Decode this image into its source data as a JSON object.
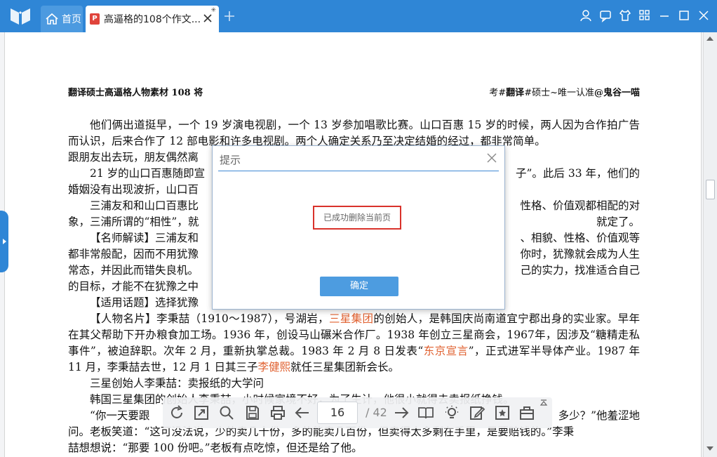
{
  "titlebar": {
    "tabs": [
      {
        "label": "首页"
      },
      {
        "label": "高逼格的108个作文..."
      }
    ]
  },
  "document": {
    "header_left": "翻译硕士高逼格人物素材 108 将",
    "header_right_prefix": "考#",
    "header_right_b1": "翻译",
    "header_right_mid": "#硕士~唯一认准",
    "header_right_b2": "@鬼谷一喵",
    "lines": [
      "他们俩出道挺早，一个 19 岁演电视剧，一个 13 岁参加唱歌比赛。山口百惠 15 岁的时候，两人因为合",
      "作拍广告而认识，后来合作了 12 部电影和许多电视剧。两个人确定关系乃至决定结婚的经过，都非常简单。",
      "跟朋友出去玩，朋友偶然离",
      "21 岁的山口百惠随即宣",
      "子”。此后 33 年，他们的",
      "婚姻没有出现波折，山口百",
      "三浦友和和山口百惠比",
      "性格、价值观都相配的对",
      "象，三浦所谓的“相性”，就",
      "就定了。",
      "【名师解读】三浦友和",
      "、相貌、性格、价值观等",
      "都非常般配，因而不用犹豫",
      "你时，犹豫就会成为人生",
      "常态，并因此而错失良机。",
      "己的实力，找准适合自己",
      "的目标，才能不在犹豫之中",
      "【适用话题】选择犹豫",
      "【人物名片】李秉喆（1910～1987），号湖岩，",
      "三星集团",
      "的创始人，是韩国庆尚南道宜宁郡出身的实",
      "业家。早年在其父帮助下开办粮食加工场。1936 年，创设马山碾米合作厂。1938 年创立三星商会，1967",
      "年，因涉及“糖精走私事件”，被迫辞职。次年 2 月，重新执掌总裁。1983 年 2 月 8 日发表“",
      "东京宣言",
      "”，正式",
      "进军半导体产业。1987 年 11 月，李秉喆去世，12 月 1 日其三子",
      "李健熙",
      "就任三星集团新会长。",
      "三星创始人李秉喆：卖报纸的大学问",
      "韩国三星集团的创始人李秉喆，小时候家境不好，为了生计，他很小就得去卖报纸挣钱。",
      "“你一天要跟",
      "多少？”他羞涩地",
      "问。老板笑道：“这可没法说，少的卖几十份，多的能卖几百份，但卖得太多剩在手里，是要赔钱的。”李秉",
      "喆想想说：“那要 100 份吧。”老板有点吃惊，但还是给了他。"
    ]
  },
  "dialog": {
    "title": "提示",
    "message": "已成功删除当前页",
    "ok_label": "确定"
  },
  "toolbar": {
    "current_page": "16",
    "total_pages": "/ 42"
  }
}
